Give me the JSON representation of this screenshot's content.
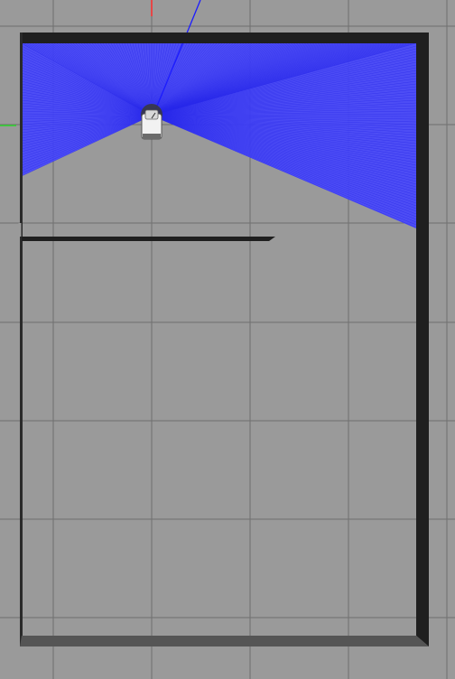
{
  "view": {
    "type": "simulator-3d-viewport-top-down",
    "background_color": "#9a9a9a",
    "grid_color": "#6f6f6f",
    "wall_color": "#1f1f1f",
    "floor_edge_color": "#555555",
    "laser_color": "#2b2bff",
    "laser_fill_color": "#4848ff",
    "axis_x_color": "#ff2a2a",
    "axis_y_color": "#2bd62b",
    "axis_z_color": "#2a2aff"
  },
  "robot": {
    "icon": "robot-icon",
    "body_color": "#f2f2f2",
    "sensor_color": "#3a3a3a"
  },
  "laser_scan": {
    "icon": "laser-scan-icon",
    "sensor": "lidar"
  }
}
